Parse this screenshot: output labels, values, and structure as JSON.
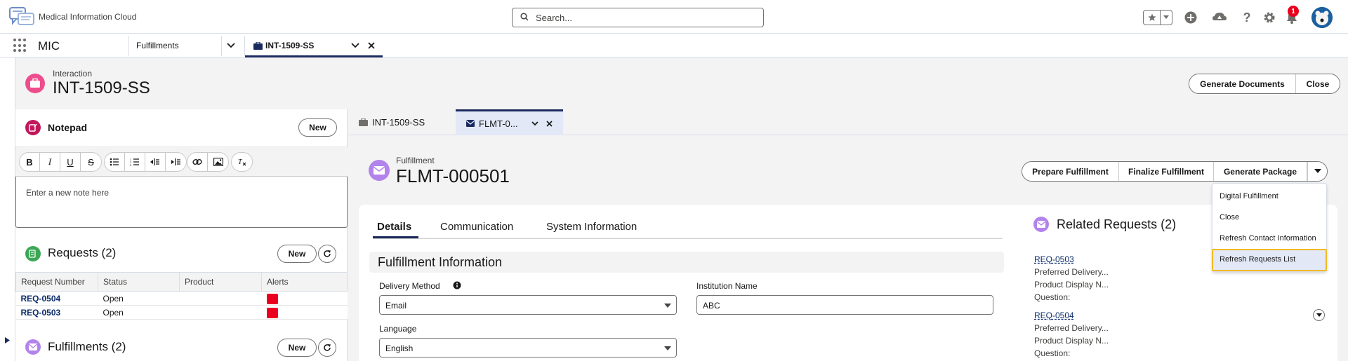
{
  "global_header": {
    "brand": "Medical Information Cloud",
    "search_placeholder": "Search...",
    "notification_count": "1"
  },
  "nav": {
    "app_name": "MIC",
    "tabs": [
      {
        "label": "Fulfillments"
      },
      {
        "label": "INT-1509-SS"
      }
    ]
  },
  "record": {
    "object_label": "Interaction",
    "title": "INT-1509-SS",
    "actions": [
      "Generate Documents",
      "Close"
    ]
  },
  "notepad": {
    "title": "Notepad",
    "new_label": "New",
    "placeholder": "Enter a new note here",
    "toolbar": {
      "bold": "B",
      "italic": "I",
      "underline": "U",
      "strike": "S"
    }
  },
  "requests": {
    "title": "Requests (2)",
    "new_label": "New",
    "columns": [
      "Request Number",
      "Status",
      "Product",
      "Alerts"
    ],
    "rows": [
      {
        "number": "REQ-0504",
        "status": "Open",
        "product": ""
      },
      {
        "number": "REQ-0503",
        "status": "Open",
        "product": ""
      }
    ]
  },
  "fulfillments": {
    "title": "Fulfillments (2)",
    "new_label": "New"
  },
  "subtabs": [
    {
      "label": "INT-1509-SS"
    },
    {
      "label": "FLMT-0..."
    }
  ],
  "fulfillment": {
    "object_label": "Fulfillment",
    "title": "FLMT-000501",
    "actions": [
      "Prepare Fulfillment",
      "Finalize Fulfillment",
      "Generate Package"
    ],
    "menu_items": [
      "Digital Fulfillment",
      "Close",
      "Refresh Contact Information",
      "Refresh Requests List"
    ]
  },
  "detail": {
    "tabs": [
      "Details",
      "Communication",
      "System Information"
    ],
    "section_title": "Fulfillment Information",
    "fields": {
      "delivery_method_label": "Delivery Method",
      "delivery_method_value": "Email",
      "institution_label": "Institution Name",
      "institution_value": "ABC",
      "language_label": "Language",
      "language_value": "English"
    }
  },
  "related": {
    "title": "Related Requests (2)",
    "items": [
      {
        "id": "REQ-0503",
        "line1": "Preferred Delivery...",
        "line2": "Product Display N...",
        "line3": "Question:"
      },
      {
        "id": "REQ-0504",
        "line1": "Preferred Delivery...",
        "line2": "Product Display N...",
        "line3": "Question:"
      }
    ]
  },
  "colors": {
    "interaction_icon": "#ed4d8c",
    "fulfillment_icon": "#b383ec",
    "notepad_icon": "#c2185b",
    "requests_icon": "#3ba755",
    "alert_flag": "#ea001e",
    "focus_ring": "#f2b927"
  }
}
